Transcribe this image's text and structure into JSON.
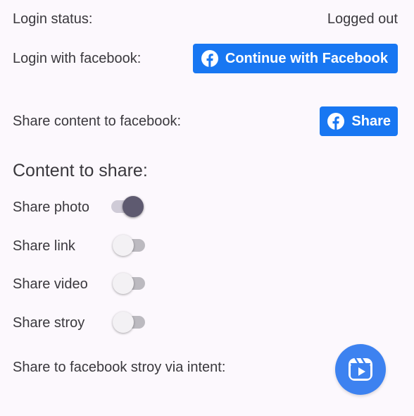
{
  "login_status": {
    "label": "Login status:",
    "value": "Logged out"
  },
  "login_facebook": {
    "label": "Login with facebook:",
    "button_label": "Continue with Facebook",
    "button_icon": "facebook-icon"
  },
  "share_content": {
    "label": "Share content to facebook:",
    "button_label": "Share",
    "button_icon": "facebook-icon"
  },
  "content_section": {
    "title": "Content to share:",
    "toggles": [
      {
        "label": "Share photo",
        "checked": true
      },
      {
        "label": "Share link",
        "checked": false
      },
      {
        "label": "Share video",
        "checked": false
      },
      {
        "label": "Share stroy",
        "checked": false
      }
    ]
  },
  "story_intent": {
    "label": "Share to facebook stroy via intent:",
    "button_icon": "reels-icon"
  },
  "colors": {
    "background": "#fcf8fd",
    "facebook_blue": "#1877f2",
    "fab_blue": "#3d82f0",
    "switch_on_thumb": "#5e5a70"
  }
}
